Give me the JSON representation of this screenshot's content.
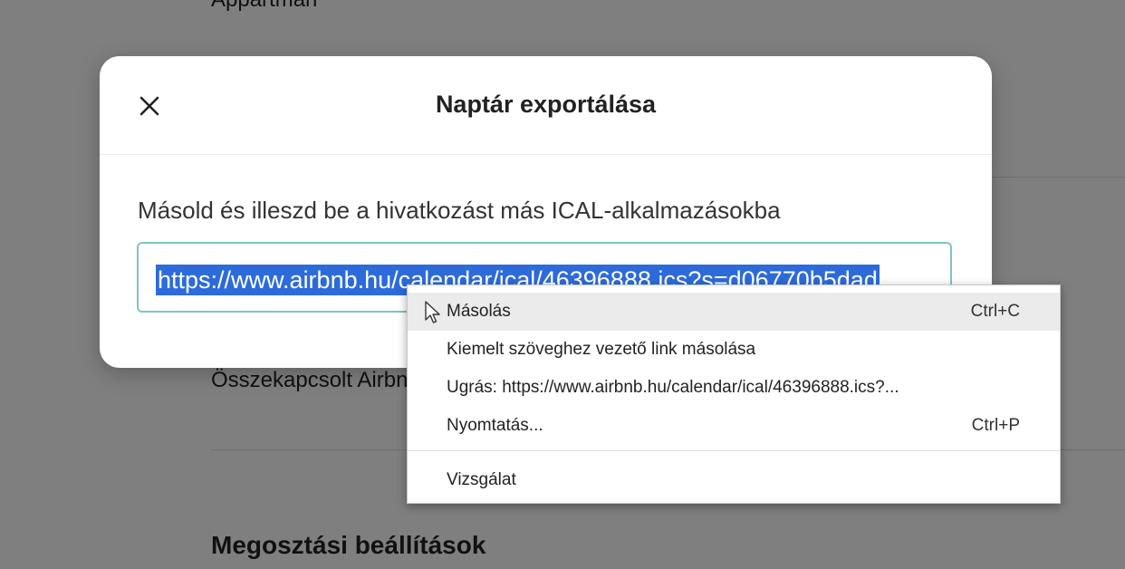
{
  "background": {
    "listing_title": "Appartman",
    "linked_calendars": "Összekapcsolt Airbnb-naptárak",
    "share_settings": "Megosztási beállítások"
  },
  "modal": {
    "title": "Naptár exportálása",
    "close_icon": "close-icon",
    "instruction": "Másold és illeszd be a hivatkozást más ICAL-alkalmazásokba",
    "link_value": "https://www.airbnb.hu/calendar/ical/46396888.ics?s=d06770b5dad"
  },
  "context_menu": {
    "items": [
      {
        "label": "Másolás",
        "shortcut": "Ctrl+C"
      },
      {
        "label": "Kiemelt szöveghez vezető link másolása",
        "shortcut": ""
      },
      {
        "label": "Ugrás: https://www.airbnb.hu/calendar/ical/46396888.ics?...",
        "shortcut": ""
      },
      {
        "label": "Nyomtatás...",
        "shortcut": "Ctrl+P"
      },
      {
        "label": "Vizsgálat",
        "shortcut": ""
      }
    ]
  },
  "colors": {
    "selection": "#2d6bdb",
    "input_border": "#7fc4c4",
    "overlay": "#000000"
  }
}
